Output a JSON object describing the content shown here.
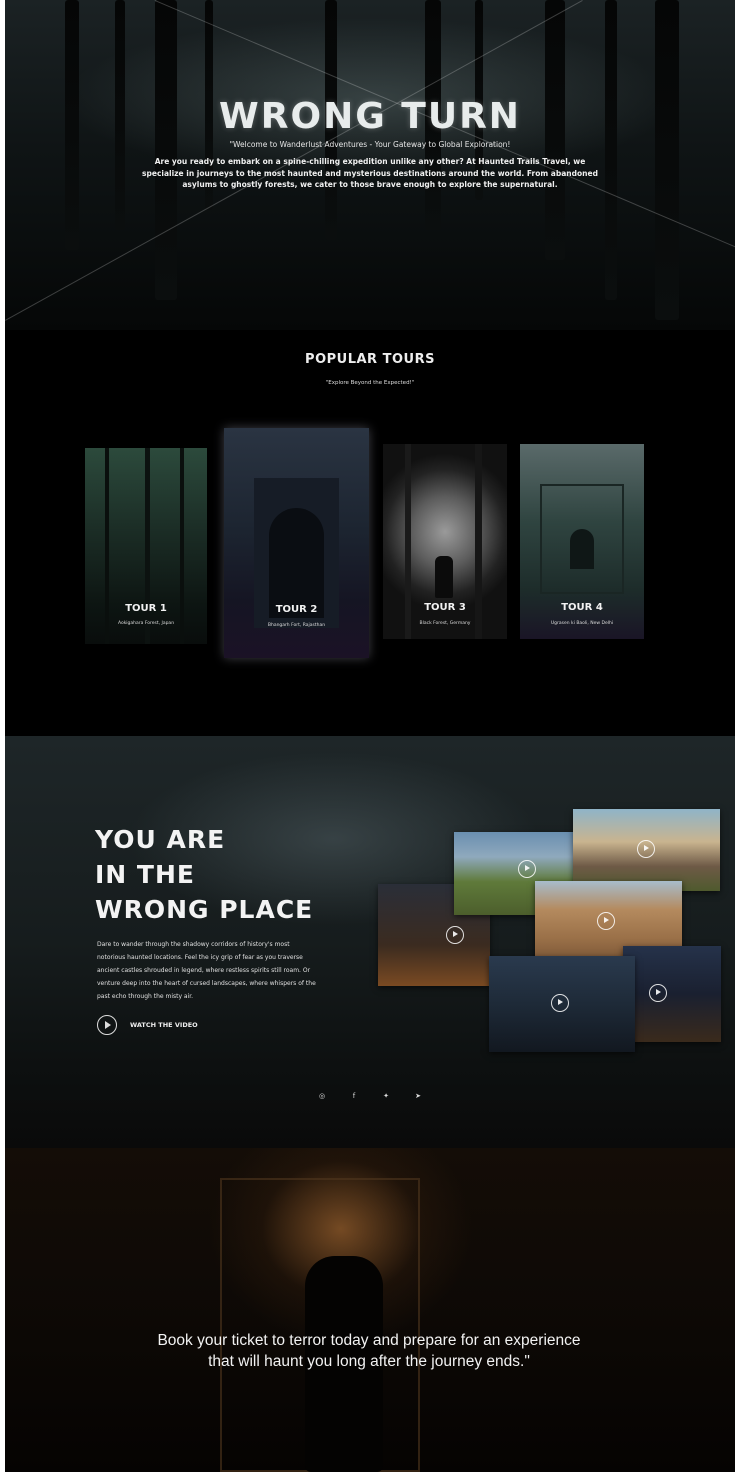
{
  "hero": {
    "title": "WRONG TURN",
    "subtitle": "\"Welcome to Wanderlust Adventures - Your Gateway to Global Exploration!",
    "body": "Are you ready to embark on a spine-chilling expedition unlike any other? At Haunted Trails Travel, we specialize in journeys to the most haunted and mysterious destinations around the world. From abandoned asylums to ghostly forests, we cater to those brave enough to explore the supernatural."
  },
  "popular": {
    "title": "POPULAR TOURS",
    "subtitle": "\"Explore Beyond the Expected!\"",
    "tours": [
      {
        "label": "TOUR 1",
        "location": "Aokigahara Forest, Japan"
      },
      {
        "label": "TOUR 2",
        "location": "Bhangarh Fort, Rajasthan"
      },
      {
        "label": "TOUR 3",
        "location": "Black Forest, Germany"
      },
      {
        "label": "TOUR 4",
        "location": "Ugrasen ki Baoli, New Delhi"
      }
    ]
  },
  "wrong_place": {
    "title_lines": [
      "YOU ARE",
      "IN THE",
      "WRONG PLACE"
    ],
    "body": "Dare to wander through the shadowy corridors of history's most notorious haunted locations. Feel the icy grip of fear as you traverse ancient castles shrouded in legend, where restless spirits still roam. Or venture deep into the heart of cursed landscapes, where whispers of the past echo through the misty air.",
    "watch_label": "WATCH THE VIDEO"
  },
  "social": [
    "instagram-icon",
    "facebook-icon",
    "twitter-icon",
    "telegram-icon"
  ],
  "book": {
    "line1": "Book your ticket to terror today and prepare for an experience",
    "line2": "that will haunt you long after the journey ends.\""
  }
}
